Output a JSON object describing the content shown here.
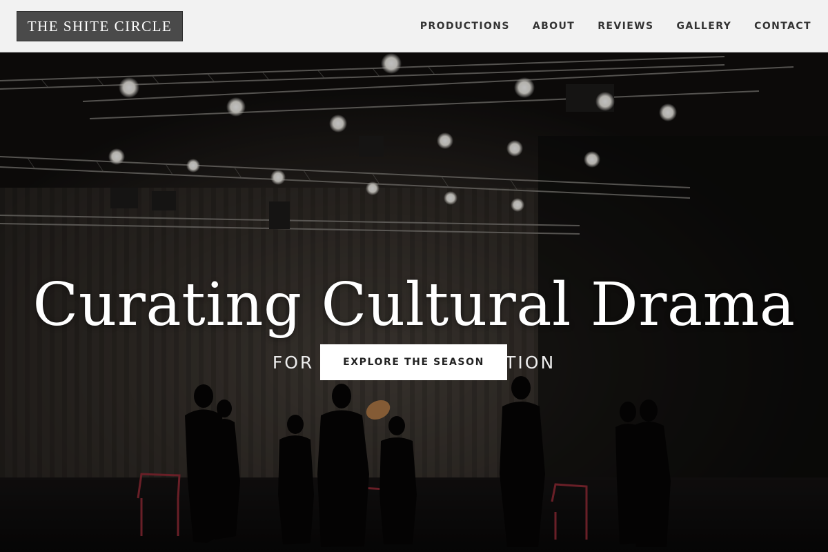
{
  "brand": {
    "name": "THE SHITE CIRCLE"
  },
  "nav": {
    "items": [
      {
        "label": "PRODUCTIONS"
      },
      {
        "label": "ABOUT"
      },
      {
        "label": "REVIEWS"
      },
      {
        "label": "GALLERY"
      },
      {
        "label": "CONTACT"
      }
    ]
  },
  "hero": {
    "title": "Curating Cultural Drama",
    "subtitle": "FOR GLOBAL RECOGNITION",
    "cta_label": "EXPLORE THE SEASON",
    "image_alt": "Actors rehearsing on a dark theatre stage under lighting rigs"
  },
  "colors": {
    "header_bg": "#f2f2f2",
    "logo_bg": "#4a4a4a",
    "nav_text": "#333333",
    "hero_text": "#ffffff",
    "cta_bg": "#ffffff"
  }
}
